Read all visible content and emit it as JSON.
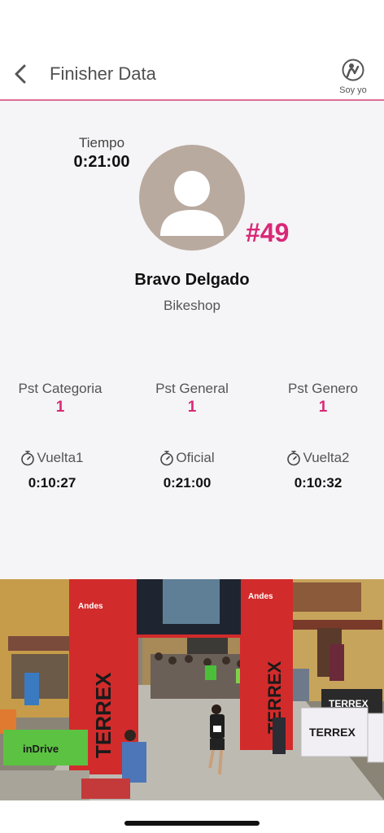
{
  "header": {
    "title": "Finisher Data",
    "soy_yo_label": "Soy yo"
  },
  "finisher": {
    "tiempo_label": "Tiempo",
    "tiempo_value": "0:21:00",
    "bib": "#49",
    "name": "Bravo Delgado",
    "team": "Bikeshop"
  },
  "positions": [
    {
      "label": "Pst Categoria",
      "value": "1"
    },
    {
      "label": "Pst General",
      "value": "1"
    },
    {
      "label": "Pst Genero",
      "value": "1"
    }
  ],
  "laps": [
    {
      "label": "Vuelta1",
      "value": "0:10:27"
    },
    {
      "label": "Oficial",
      "value": "0:21:00"
    },
    {
      "label": "Vuelta2",
      "value": "0:10:32"
    }
  ],
  "photo": {
    "arch_brand": "TERREX",
    "banner_brand": "Andes",
    "sponsor_left": "inDrive",
    "barrier_brand": "TERREX"
  },
  "colors": {
    "accent": "#d92877",
    "divider": "#e06c93",
    "avatar_bg": "#b9aaa0"
  }
}
